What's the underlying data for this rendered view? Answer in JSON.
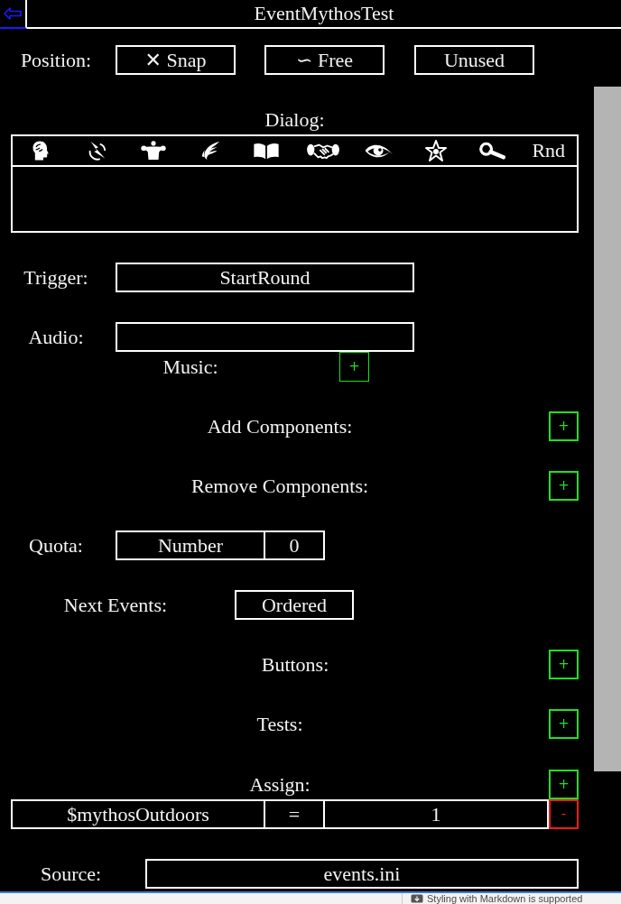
{
  "title_bar": {
    "title": "EventMythosTest"
  },
  "position": {
    "label": "Position:",
    "options": [
      "✕ Snap",
      "∽ Free",
      "Unused"
    ]
  },
  "dialog": {
    "label": "Dialog:",
    "random_button": "Rnd"
  },
  "trigger": {
    "label": "Trigger:",
    "value": "StartRound"
  },
  "audio": {
    "label": "Audio:"
  },
  "music": {
    "label": "Music:",
    "add_button": "+"
  },
  "add_components": {
    "label": "Add Components:",
    "add_button": "+"
  },
  "remove_components": {
    "label": "Remove Components:",
    "add_button": "+"
  },
  "quota": {
    "label": "Quota:",
    "type": "Number",
    "value": "0"
  },
  "next_events": {
    "label": "Next Events:",
    "value": "Ordered"
  },
  "buttons": {
    "label": "Buttons:",
    "add_button": "+"
  },
  "tests": {
    "label": "Tests:",
    "add_button": "+"
  },
  "assign": {
    "label": "Assign:",
    "add_button": "+",
    "rows": [
      {
        "variable": "$mythosOutdoors",
        "operator": "=",
        "value": "1",
        "remove_button": "-"
      }
    ]
  },
  "source": {
    "label": "Source:",
    "value": "events.ini"
  },
  "page_footer": {
    "note": "Styling with Markdown is supported"
  }
}
